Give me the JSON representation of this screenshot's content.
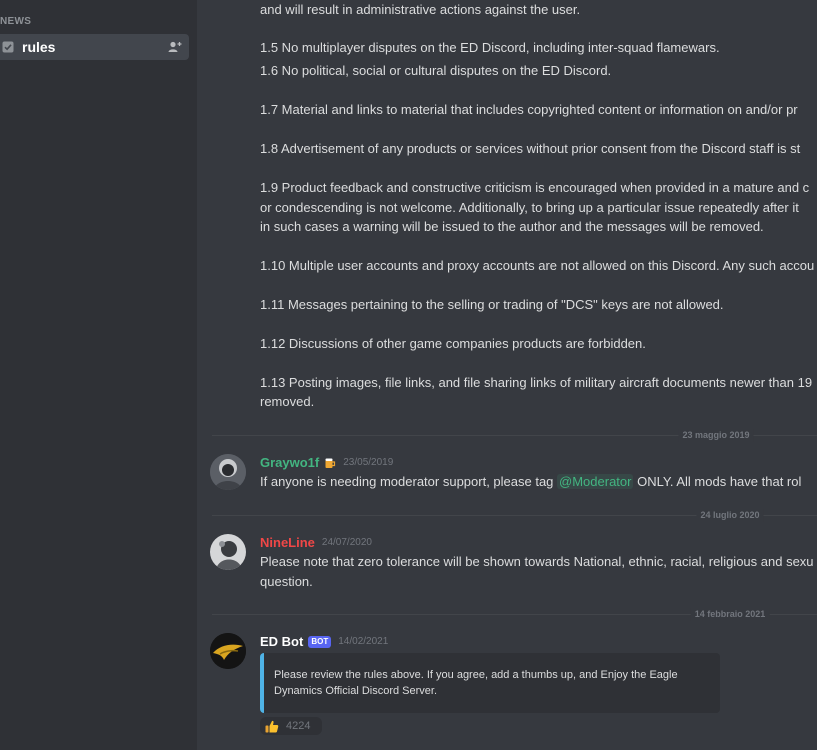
{
  "sidebar": {
    "category": "NEWS",
    "channel": {
      "name": "rules",
      "icon": "announcement-check-icon",
      "action_icon": "add-member-icon"
    }
  },
  "rules": [
    "and will result in administrative actions against the user.",
    "1.5 No multiplayer disputes on the ED Discord, including inter-squad flamewars.",
    "1.6 No political, social or cultural disputes on the ED Discord.",
    "1.7 Material and links to material that includes copyrighted content or information on and/or pr",
    "1.8 Advertisement of any products or services without prior consent from the Discord staff is st",
    "1.9 Product feedback and constructive criticism is encouraged when provided in a mature and c",
    "or condescending is not welcome. Additionally, to bring up a particular issue repeatedly after it",
    "in such cases a warning will be issued to the author and the messages will be removed.",
    "1.10 Multiple user accounts and proxy accounts are not allowed on this Discord. Any such accou",
    "1.11 Messages pertaining to the selling or trading of \"DCS\" keys are not allowed.",
    "1.12 Discussions of other game companies products are forbidden.",
    "1.13 Posting images, file links, and file sharing links of military aircraft documents newer than 19",
    "removed."
  ],
  "dividers": [
    "23 maggio 2019",
    "24 luglio 2020",
    "14 febbraio 2021"
  ],
  "messages": [
    {
      "author": "Graywo1f",
      "author_color": "#43b581",
      "badge_icon": "beer-mug-icon",
      "timestamp": "23/05/2019",
      "text_before": "If anyone is needing moderator support, please tag ",
      "mention": "@Moderator",
      "text_after": " ONLY. All mods have that rol"
    },
    {
      "author": "NineLine",
      "author_color": "#f04747",
      "timestamp": "24/07/2020",
      "line1": "Please note that zero tolerance will be shown towards National, ethnic, racial, religious and sexu",
      "line2": "question."
    },
    {
      "author": "ED Bot",
      "author_color": "#ffffff",
      "bot_tag": "BOT",
      "timestamp": "14/02/2021",
      "embed": {
        "line1": "Please review the rules above. If you agree, add a thumbs up, and Enjoy the Eagle",
        "line2": "Dynamics Official Discord Server."
      },
      "reaction": {
        "emoji": "thumbs-up-icon",
        "count": "4224"
      }
    }
  ],
  "colors": {
    "background": "#36393f",
    "sidebar": "#2f3136",
    "mention": "#43b581",
    "embed_accent": "#4fb3e6",
    "bot_badge": "#5865f2"
  }
}
